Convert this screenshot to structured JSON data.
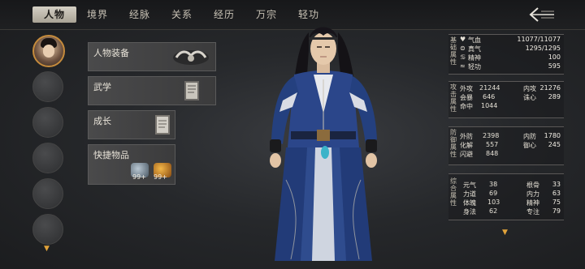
{
  "tabs": [
    {
      "label": "人物",
      "active": true
    },
    {
      "label": "境界"
    },
    {
      "label": "经脉"
    },
    {
      "label": "关系"
    },
    {
      "label": "经历"
    },
    {
      "label": "万宗"
    },
    {
      "label": "轻功"
    }
  ],
  "menu": {
    "equipment": "人物装备",
    "martial": "武学",
    "growth": "成长",
    "quick_items": "快捷物品",
    "quick_item_counts": [
      "99+",
      "99+"
    ]
  },
  "stats": {
    "basic": {
      "category": "基础属性",
      "rows": [
        {
          "icon": "heart-icon",
          "label": "气血",
          "value": "11077/11077"
        },
        {
          "icon": "flask-icon",
          "label": "真气",
          "value": "1295/1295"
        },
        {
          "icon": "swirl-icon",
          "label": "精神",
          "value": "100"
        },
        {
          "icon": "dash-icon",
          "label": "轻功",
          "value": "595"
        }
      ]
    },
    "offense": {
      "category": "攻击属性",
      "rows": [
        [
          {
            "label": "外攻",
            "value": "21244"
          },
          {
            "label": "内攻",
            "value": "21276"
          }
        ],
        [
          {
            "label": "会暴",
            "value": "646"
          },
          {
            "label": "诛心",
            "value": "289"
          }
        ],
        [
          {
            "label": "命中",
            "value": "1044"
          }
        ]
      ]
    },
    "defense": {
      "category": "防御属性",
      "rows": [
        [
          {
            "label": "外防",
            "value": "2398"
          },
          {
            "label": "内防",
            "value": "1780"
          }
        ],
        [
          {
            "label": "化解",
            "value": "557"
          },
          {
            "label": "御心",
            "value": "245"
          }
        ],
        [
          {
            "label": "闪避",
            "value": "848"
          }
        ]
      ]
    },
    "combined": {
      "category": "综合属性",
      "rows": [
        [
          {
            "label": "元气",
            "value": "38"
          },
          {
            "label": "根骨",
            "value": "33"
          }
        ],
        [
          {
            "label": "力道",
            "value": "69"
          },
          {
            "label": "内力",
            "value": "63"
          }
        ],
        [
          {
            "label": "体魄",
            "value": "103"
          },
          {
            "label": "精神",
            "value": "75"
          }
        ],
        [
          {
            "label": "身法",
            "value": "62"
          },
          {
            "label": "专注",
            "value": "79"
          }
        ]
      ]
    }
  },
  "colors": {
    "accent": "#e0a23a",
    "active_tab": "#cfc9bc",
    "panel": "#464647"
  }
}
